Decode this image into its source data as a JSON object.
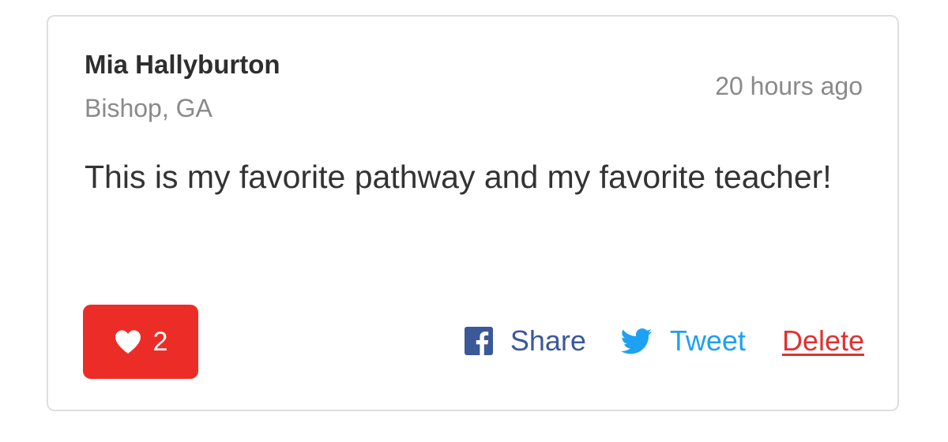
{
  "comment": {
    "author_name": "Mia Hallyburton",
    "author_location": "Bishop, GA",
    "timestamp": "20 hours ago",
    "body": "This is my favorite pathway and my favorite teacher!"
  },
  "like": {
    "icon": "heart-icon",
    "count": "2"
  },
  "actions": {
    "share_icon": "facebook-icon",
    "share_label": "Share",
    "tweet_icon": "twitter-icon",
    "tweet_label": "Tweet",
    "delete_label": "Delete"
  },
  "colors": {
    "like_button_bg": "#ec2d27",
    "facebook": "#3b5998",
    "twitter": "#1da1f2",
    "delete": "#e0322f",
    "muted_text": "#8a8a8a",
    "card_border": "#dedede"
  }
}
